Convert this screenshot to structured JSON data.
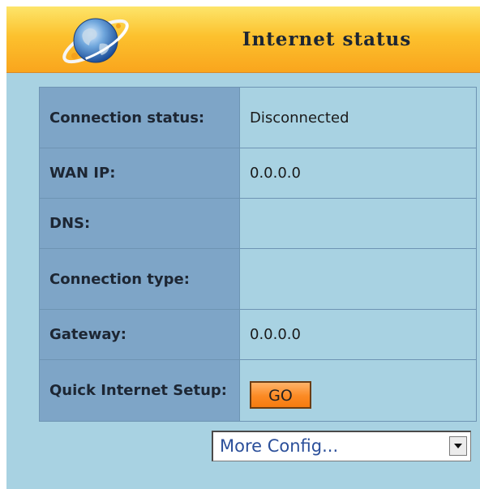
{
  "header": {
    "title": "Internet status",
    "icon": "globe-icon"
  },
  "status_table": {
    "rows": [
      {
        "label": "Connection status:",
        "value": "Disconnected"
      },
      {
        "label": "WAN IP:",
        "value": "0.0.0.0"
      },
      {
        "label": "DNS:",
        "value": ""
      },
      {
        "label": "Connection type:",
        "value": ""
      },
      {
        "label": "Gateway:",
        "value": "0.0.0.0"
      },
      {
        "label": "Quick Internet Setup:",
        "button_label": "GO"
      }
    ]
  },
  "more_config": {
    "selected": "More Config...",
    "icon": "chevron-down-icon"
  },
  "colors": {
    "header_top": "#fde56a",
    "header_bottom": "#f9a51d",
    "panel_background": "#a8d2e2",
    "label_cell": "#7ea5c7",
    "go_button": "#fb8a24",
    "select_text": "#2b4f9a"
  }
}
